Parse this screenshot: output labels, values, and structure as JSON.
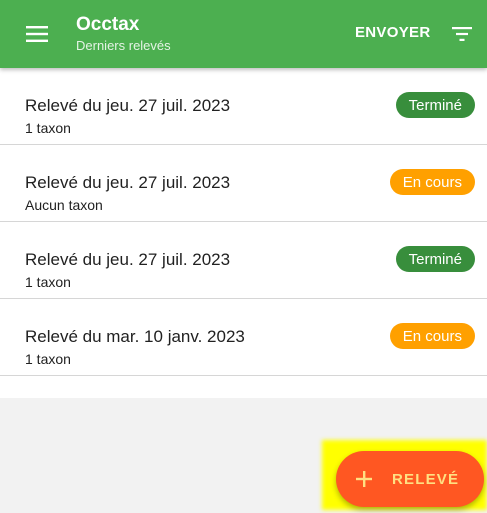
{
  "header": {
    "title": "Occtax",
    "subtitle": "Derniers relevés",
    "send_label": "ENVOYER"
  },
  "records": [
    {
      "title": "Relevé du jeu. 27 juil. 2023",
      "subtitle": "1 taxon",
      "status": "Terminé",
      "status_type": "done"
    },
    {
      "title": "Relevé du jeu. 27 juil. 2023",
      "subtitle": "Aucun taxon",
      "status": "En cours",
      "status_type": "progress"
    },
    {
      "title": "Relevé du jeu. 27 juil. 2023",
      "subtitle": "1 taxon",
      "status": "Terminé",
      "status_type": "done"
    },
    {
      "title": "Relevé du mar. 10 janv. 2023",
      "subtitle": "1 taxon",
      "status": "En cours",
      "status_type": "progress"
    }
  ],
  "fab": {
    "label": "RELEVÉ"
  },
  "colors": {
    "appbar": "#4caf50",
    "done": "#388e3c",
    "progress": "#ffa000",
    "fab": "#ff5722",
    "highlight": "#ffff00"
  }
}
